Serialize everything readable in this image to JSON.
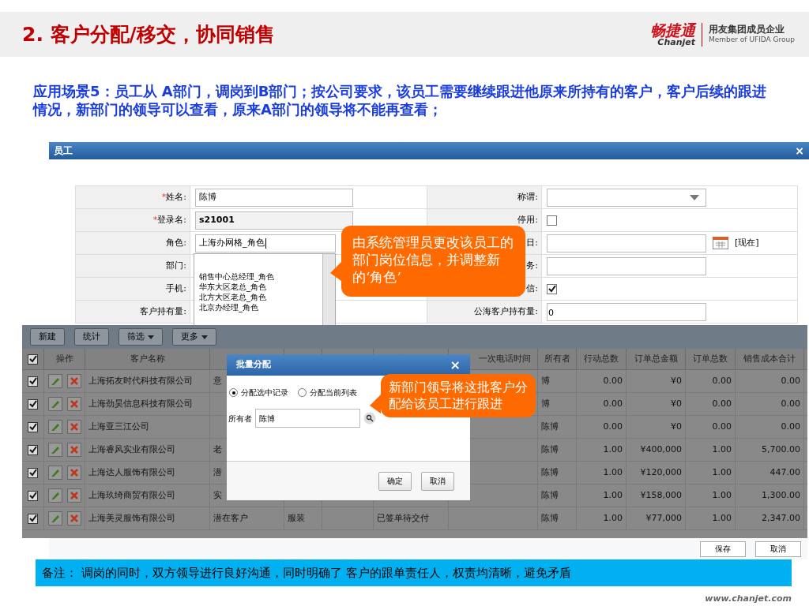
{
  "header": {
    "title": "2. 客户分配/移交，协同销售",
    "logo_cn": "畅捷通",
    "logo_en": "Chanjet",
    "group_cn": "用友集团成员企业",
    "group_en": "Member of UFIDA Group"
  },
  "scenario": "应用场景5：员工从 A部门，调岗到B部门；按公司要求，该员工需要继续跟进他原来所持有的客户，客户后续的跟进情况，新部门的领导可以查看，原来A部门的领导将不能再查看；",
  "employee_dialog": {
    "title": "员工",
    "close": "×",
    "left_fields": [
      {
        "label": "姓名:",
        "required_mark": "*",
        "value": "陈博",
        "kind": "text"
      },
      {
        "label": "登录名:",
        "required_mark": "*",
        "value": "s21001",
        "kind": "text"
      },
      {
        "label": "角色:",
        "value": "上海办网格_角色",
        "kind": "combo"
      },
      {
        "label": "部门:",
        "kind": "blank"
      },
      {
        "label": "手机:",
        "kind": "blank"
      },
      {
        "label": "客户持有量:",
        "kind": "blank"
      }
    ],
    "right_fields": [
      {
        "label": "称谓:",
        "kind": "select"
      },
      {
        "label": "停用:",
        "kind": "checkbox",
        "checked": false
      },
      {
        "label": "日:",
        "kind": "date",
        "link": "[现在]"
      },
      {
        "label": "务:",
        "kind": "text"
      },
      {
        "label": "信:",
        "kind": "checkbox",
        "checked": true
      },
      {
        "label": "公海客户持有量:",
        "kind": "text",
        "value": "0"
      }
    ],
    "role_options": [
      "销售中心总经理_角色",
      "华东大区老总_角色",
      "北方大区老总_角色",
      "北京办经理_角色"
    ],
    "callout": "由系统管理员更改该员工的部门岗位信息，并调整新的‘角色’"
  },
  "grid": {
    "toolbar": [
      {
        "label": "新建",
        "menu": false
      },
      {
        "label": "统计",
        "menu": false
      },
      {
        "label": "筛选",
        "menu": true
      },
      {
        "label": "更多",
        "menu": true
      }
    ],
    "header_checked": true,
    "columns": [
      "操作",
      "客户名称",
      "一次电话时间",
      "所有者",
      "行动总数",
      "订单总金额",
      "订单总数",
      "销售成本合计"
    ],
    "rows": [
      {
        "checked": true,
        "name": "上海拓友时代科技有限公司",
        "col_4": "意",
        "owner": "博",
        "actions": "0.00",
        "amount": "¥0",
        "orders": "0.00",
        "cost": "0.00"
      },
      {
        "checked": true,
        "name": "上海劲昊信息科技有限公司",
        "owner": "博",
        "actions": "0.00",
        "amount": "¥0",
        "orders": "0.00",
        "cost": "0.00"
      },
      {
        "checked": true,
        "name": "上海亚三江公司",
        "owner": "陈博",
        "actions": "0.00",
        "amount": "¥0",
        "orders": "0.00",
        "cost": "0.00"
      },
      {
        "checked": true,
        "name": "上海睿风实业有限公司",
        "col_4": "老",
        "owner": "陈博",
        "actions": "1.00",
        "amount": "¥400,000",
        "orders": "1.00",
        "cost": "5,700.00"
      },
      {
        "checked": true,
        "name": "上海达人服饰有限公司",
        "col_4": "潜",
        "owner": "陈博",
        "actions": "1.00",
        "amount": "¥120,000",
        "orders": "1.00",
        "cost": "447.00"
      },
      {
        "checked": true,
        "name": "上海玖绮商贸有限公司",
        "col_4": "实",
        "owner": "陈博",
        "actions": "1.00",
        "amount": "¥158,000",
        "orders": "1.00",
        "cost": "1,300.00"
      },
      {
        "checked": true,
        "name": "上海美灵服饰有限公司",
        "col_4": "潜在客户",
        "col_5": "服装",
        "col_7": "已签单待交付",
        "owner": "陈博",
        "actions": "1.00",
        "amount": "¥77,000",
        "orders": "1.00",
        "cost": "2,347.00"
      }
    ],
    "footer_buttons": [
      "保存",
      "取消"
    ]
  },
  "assign_dialog": {
    "title": "批量分配",
    "close": "×",
    "options": [
      {
        "label": "分配选中记录",
        "selected": true
      },
      {
        "label": "分配当前列表",
        "selected": false
      }
    ],
    "owner_label": "所有者",
    "owner_value": "陈博",
    "buttons": [
      "确定",
      "取消"
    ],
    "callout": "新部门领导将这批客户分配给该员工进行跟进"
  },
  "note": "备注： 调岗的同时，双方领导进行良好沟通，同时明确了 客户的跟单责任人，权责均清晰，避免矛盾",
  "footer": "www.chanjet.com"
}
